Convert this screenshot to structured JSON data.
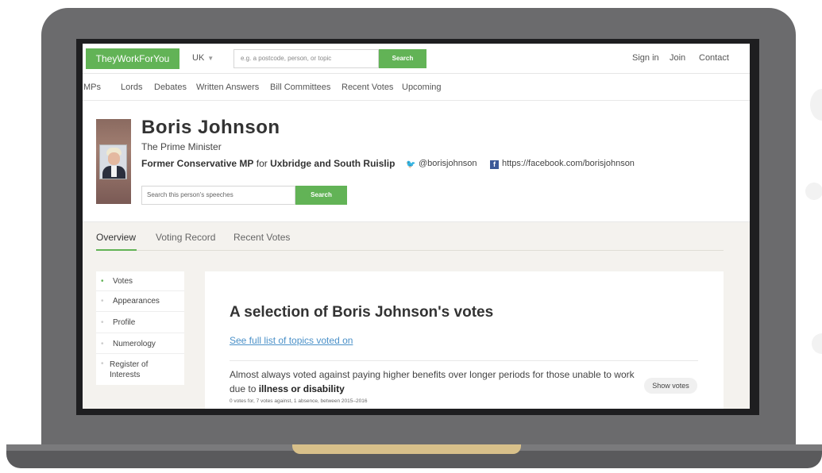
{
  "header": {
    "brand": "TheyWorkForYou",
    "country": "UK",
    "search_placeholder": "e.g. a postcode, person, or topic",
    "search_button": "Search",
    "links": [
      "Sign in",
      "Join",
      "Contact"
    ]
  },
  "nav": {
    "items": [
      "MPs",
      "Lords",
      "Debates",
      "Written Answers",
      "Bill Committees",
      "Recent Votes",
      "Upcoming"
    ]
  },
  "person": {
    "name": "Boris Johnson",
    "role": "The Prime Minister",
    "mp_prefix": "Former Conservative MP",
    "mp_for": "for",
    "constituency": "Uxbridge and South Ruislip",
    "twitter": "@borisjohnson",
    "facebook": "https://facebook.com/borisjohnson",
    "search_placeholder": "Search this person's speeches",
    "search_button": "Search"
  },
  "tabs": [
    "Overview",
    "Voting Record",
    "Recent Votes"
  ],
  "sidenav": {
    "items": [
      "Votes",
      "Appearances",
      "Profile",
      "Numerology",
      "Register of Interests"
    ]
  },
  "votes_panel": {
    "title": "A selection of Boris Johnson's votes",
    "full_list_link": "See full list of topics voted on",
    "vote_text": "Almost always voted against paying higher benefits over longer periods for those unable to work due to",
    "vote_text_bold": "illness or disability",
    "vote_meta": "0 votes for, 7 votes against, 1 absence, between 2015–2016",
    "show_votes": "Show votes"
  },
  "colors": {
    "accent_green": "#62b356",
    "link_blue": "#4a90c8",
    "twitter_blue": "#1da1f2",
    "facebook_blue": "#3b5998",
    "laptop_gray": "#6b6b6d"
  },
  "icons": {
    "twitter": "twitter-icon",
    "facebook": "facebook-icon",
    "country_caret": "chevron-down-icon"
  }
}
